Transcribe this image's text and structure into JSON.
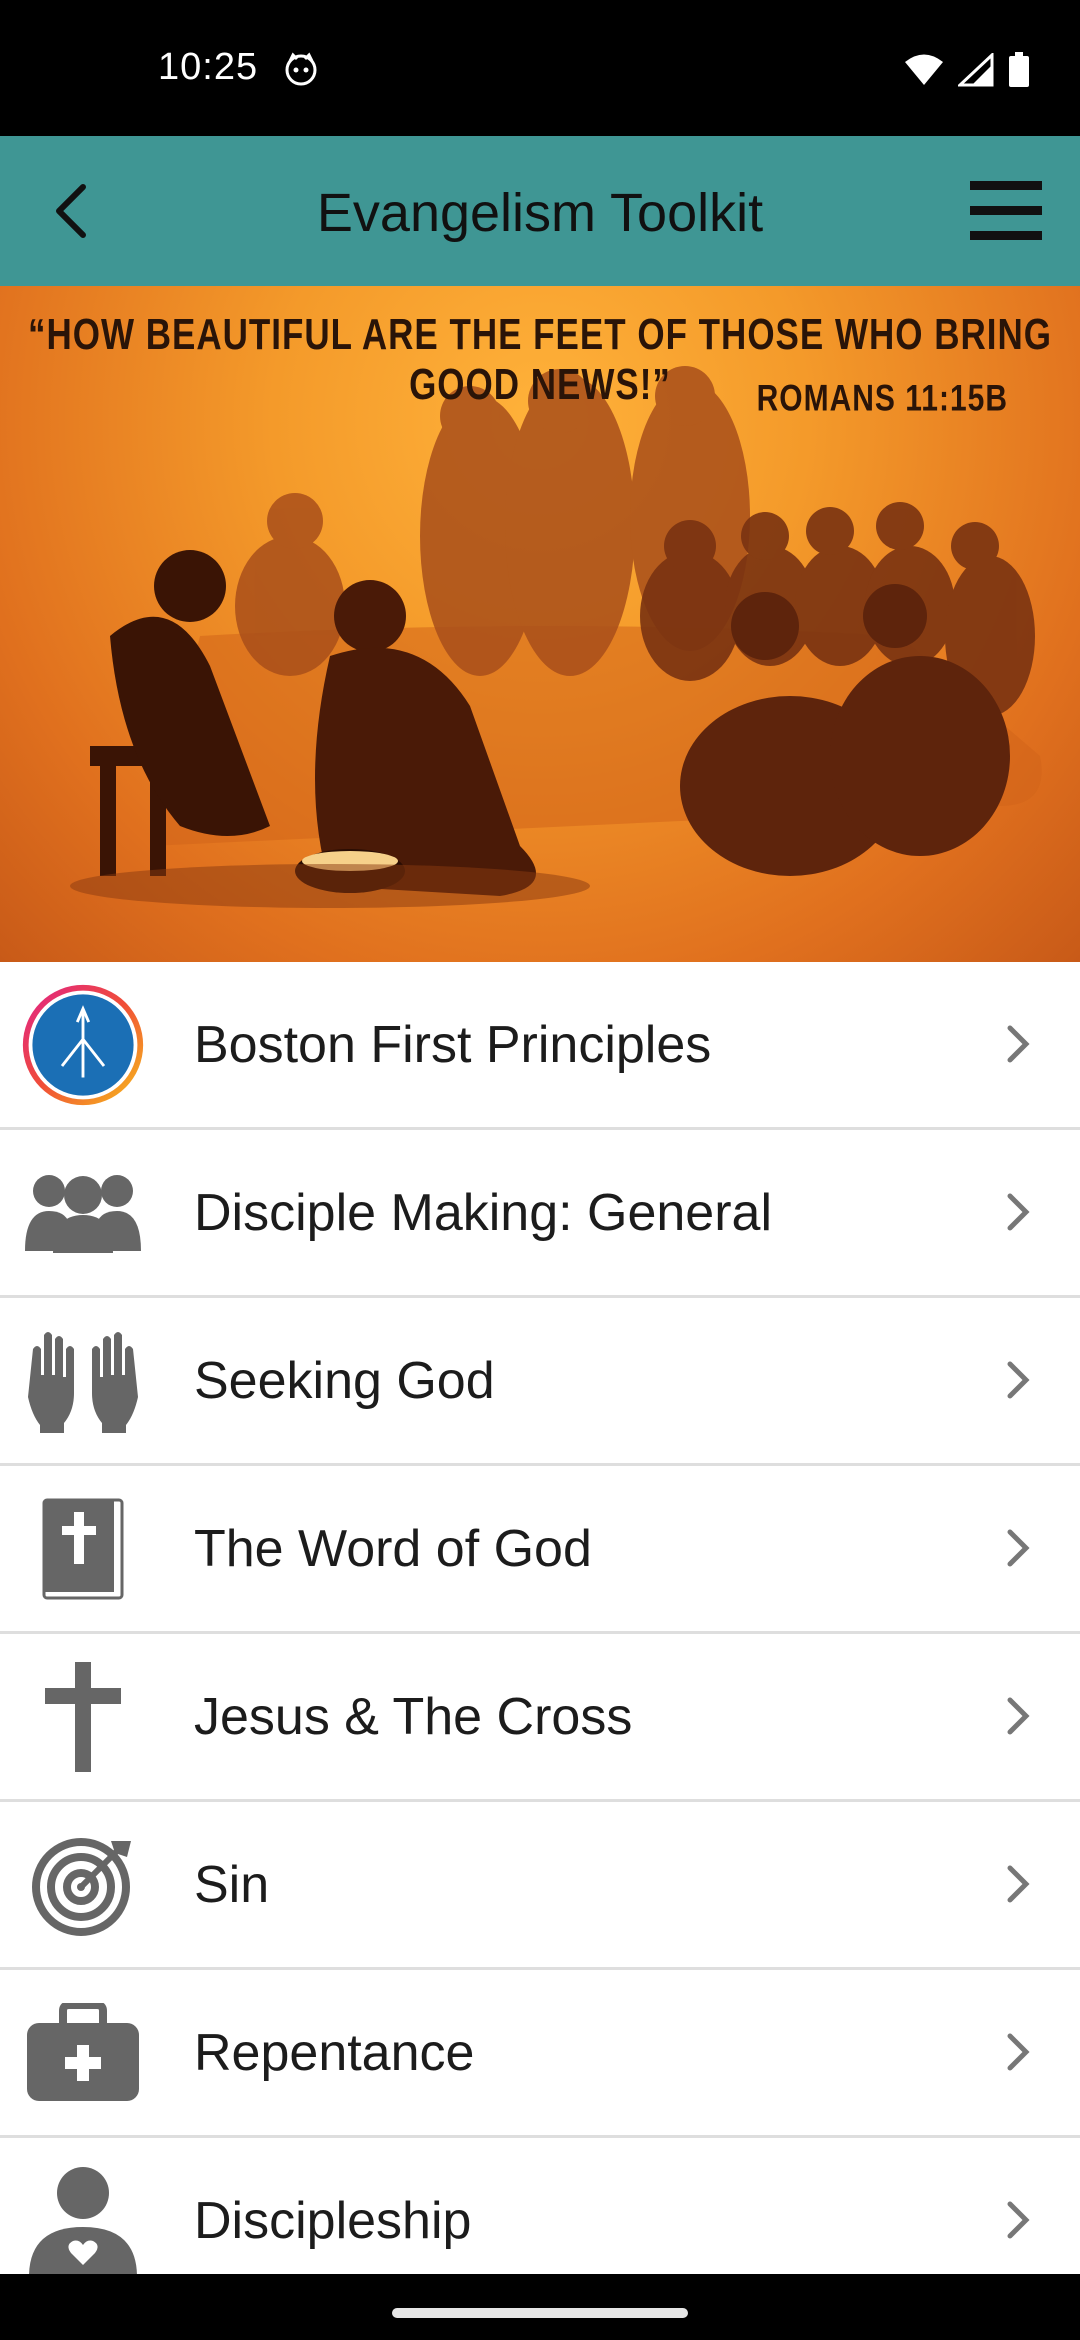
{
  "status_bar": {
    "time": "10:25",
    "icons": [
      "cat-face-icon",
      "wifi-icon",
      "cell-signal-icon",
      "battery-icon"
    ]
  },
  "app_bar": {
    "title": "Evangelism Toolkit",
    "back_icon": "back-arrow-icon",
    "menu_icon": "hamburger-menu-icon",
    "background_color": "#3F9694"
  },
  "banner": {
    "quote": "“HOW BEAUTIFUL ARE THE FEET OF THOSE WHO BRING GOOD NEWS!”",
    "reference": "ROMANS 11:15B"
  },
  "list": {
    "items": [
      {
        "label": "Boston First Principles",
        "icon": "boston-logo-icon"
      },
      {
        "label": "Disciple Making: General",
        "icon": "group-icon"
      },
      {
        "label": "Seeking God",
        "icon": "praying-hands-icon"
      },
      {
        "label": "The Word of God",
        "icon": "bible-icon"
      },
      {
        "label": "Jesus & The Cross",
        "icon": "cross-icon"
      },
      {
        "label": "Sin",
        "icon": "target-arrow-icon"
      },
      {
        "label": "Repentance",
        "icon": "first-aid-kit-icon"
      },
      {
        "label": "Discipleship",
        "icon": "person-heart-icon"
      }
    ]
  }
}
